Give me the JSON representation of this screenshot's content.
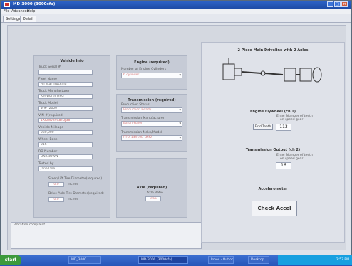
{
  "window": {
    "title": "MD-3000 (3000sfa)"
  },
  "menu": [
    "File",
    "Advanced",
    "Help"
  ],
  "tabs": [
    "Settings",
    "Detail"
  ],
  "vehicle": {
    "title": "Vehicle Info",
    "fields": [
      {
        "label": "Truck Serial #",
        "value": ""
      },
      {
        "label": "Fleet Name",
        "value": "All Star Trucking"
      },
      {
        "label": "Truck Manufacturer",
        "value": "Kenworth MFG"
      },
      {
        "label": "Truck Model",
        "value": "W9/T2000"
      },
      {
        "label": "VIN #(required)",
        "value": "1XKWDB9X8Y5J38"
      },
      {
        "label": "Vehicle Mileage",
        "value": "230,000"
      },
      {
        "label": "Wheel Base",
        "value": "216"
      },
      {
        "label": "RO Number",
        "value": "UNKNOWN"
      },
      {
        "label": "Tested by",
        "value": "Jane Doe"
      }
    ],
    "tire1_label": "Steer/Lift Tire Diameter(required)",
    "tire1_value": "0.0",
    "tire2_label": "Drive Axle Tire Diameter(required)",
    "tire2_value": "0.0",
    "units": "Inches"
  },
  "engine": {
    "title": "Engine (required)",
    "cyl_label": "Number of Engine Cylinders",
    "cyl_value": "6 cylinder"
  },
  "transmission": {
    "title": "Transmission (required)",
    "prod_label": "Production Status",
    "prod_value": "Production Ready",
    "mfr_label": "Transmission Manufacturer",
    "mfr_value": "Eaton-Fuller",
    "model_label": "Transmission Make/Model",
    "model_value": "RTO-14910B-DM2"
  },
  "axle": {
    "title": "Axle (required)",
    "ratio_label": "Axle Ratio",
    "ratio_value": "3.55"
  },
  "comments_label": "Vibration complaint",
  "right": {
    "diagram_title": "2 Piece Main Driveline with 2 Axles",
    "flywheel_title": "Engine Flywheel (ch 1)",
    "flywheel_sub1": "Enter Number of teeth",
    "flywheel_sub2": "on speed gear",
    "find_teeth": "Find Teeth",
    "flywheel_value": "113",
    "output_title": "Transmission Output (ch 2)",
    "output_sub1": "Enter Number of teeth",
    "output_sub2": "on speed gear",
    "output_value": "16",
    "accel_title": "Accelerometer",
    "check_accel": "Check Accel"
  },
  "taskbar": {
    "start": "start",
    "items": [
      "MD_3000",
      "MD-3000 (3000sfa)",
      "Inbox - Outlook",
      "Desktop"
    ],
    "clock": "2:57 PM"
  }
}
